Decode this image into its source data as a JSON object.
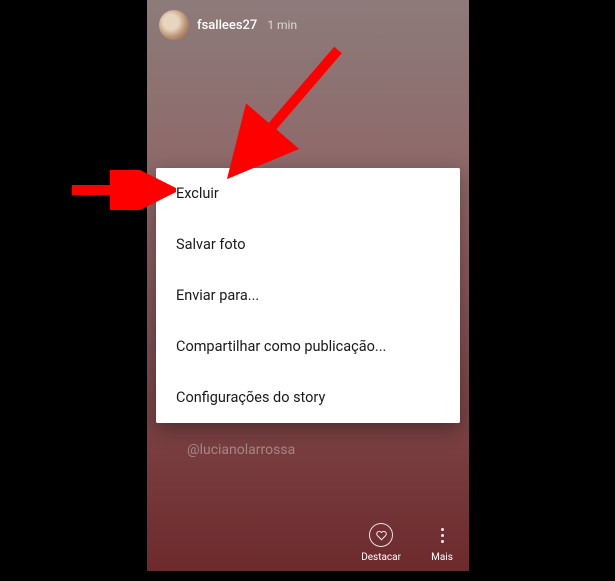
{
  "story": {
    "username": "fsallees27",
    "timestamp": "1 min",
    "mention": "@lucianolarrossa"
  },
  "dialog": {
    "items": [
      {
        "label": "Excluir"
      },
      {
        "label": "Salvar foto"
      },
      {
        "label": "Enviar para..."
      },
      {
        "label": "Compartilhar como publicação..."
      },
      {
        "label": "Configurações do story"
      }
    ]
  },
  "bottom": {
    "highlight_label": "Destacar",
    "more_label": "Mais"
  },
  "annotations": {
    "arrow_color": "#ff0000"
  }
}
